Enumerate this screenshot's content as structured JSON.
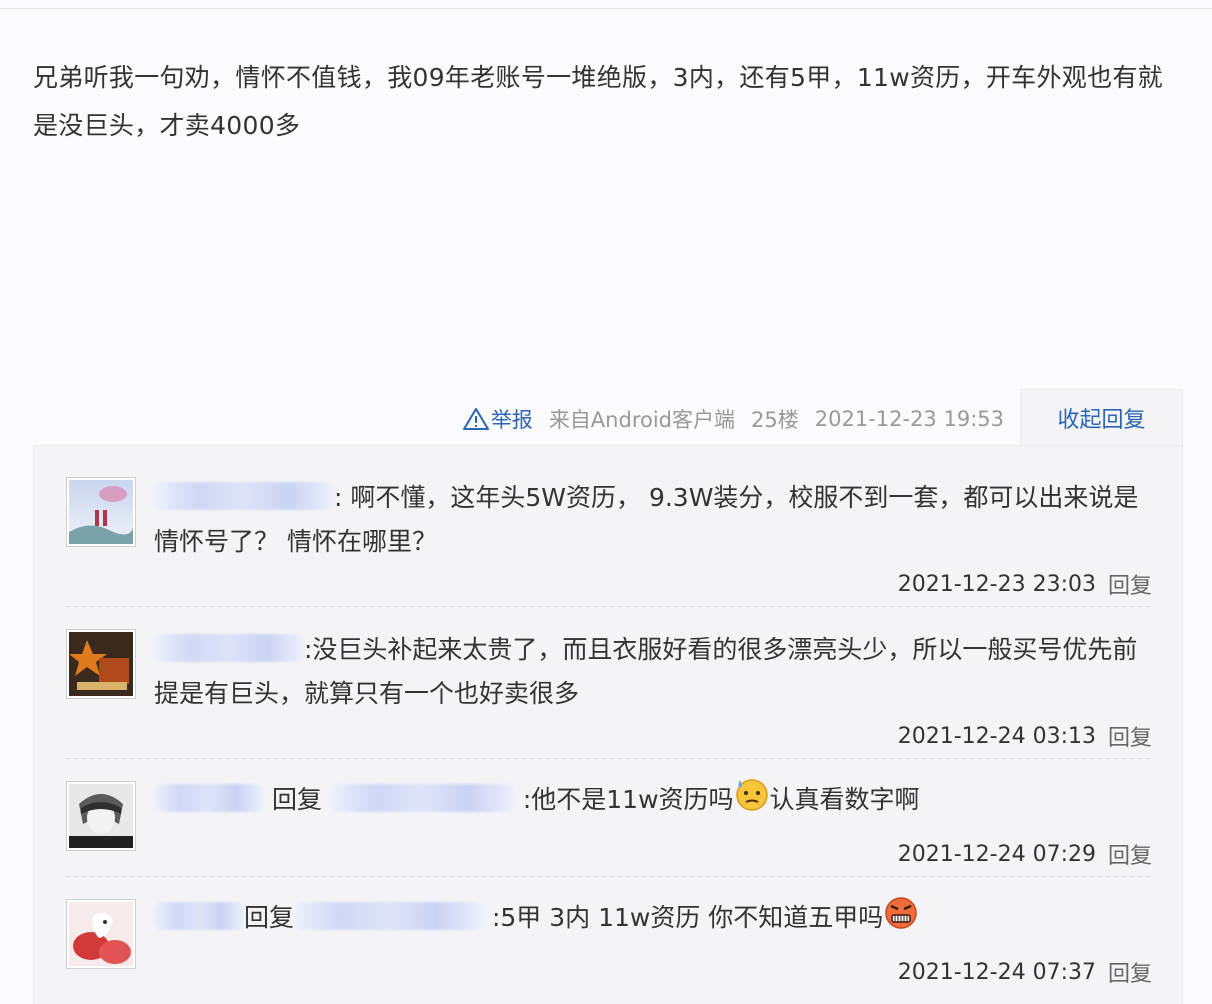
{
  "post": {
    "body": "兄弟听我一句劝，情怀不值钱，我09年老账号一堆绝版，3内，还有5甲，11w资历，开车外观也有就是没巨头，才卖4000多",
    "report_label": "举报",
    "source": "来自Android客户端",
    "floor": "25楼",
    "timestamp": "2021-12-23 19:53",
    "collapse_label": "收起回复"
  },
  "replies": [
    {
      "segments": [
        {
          "type": "name"
        },
        {
          "type": "text",
          "value": ": 啊不懂，这年头5W资历， 9.3W装分，校服不到一套，都可以出来说是情怀号了？ 情怀在哪里？"
        }
      ],
      "timestamp": "2021-12-23 23:03",
      "reply_label": "回复"
    },
    {
      "segments": [
        {
          "type": "name"
        },
        {
          "type": "text",
          "value": ":没巨头补起来太贵了，而且衣服好看的很多漂亮头少，所以一般买号优先前提是有巨头，就算只有一个也好卖很多"
        }
      ],
      "timestamp": "2021-12-24 03:13",
      "reply_label": "回复"
    },
    {
      "segments": [
        {
          "type": "name"
        },
        {
          "type": "text",
          "value": " 回复 "
        },
        {
          "type": "name"
        },
        {
          "type": "text",
          "value": " :他不是11w资历吗"
        },
        {
          "type": "emoji",
          "icon": "sweat-emoji-icon"
        },
        {
          "type": "text",
          "value": "认真看数字啊"
        }
      ],
      "timestamp": "2021-12-24 07:29",
      "reply_label": "回复"
    },
    {
      "segments": [
        {
          "type": "name"
        },
        {
          "type": "text",
          "value": "回复"
        },
        {
          "type": "name"
        },
        {
          "type": "text",
          "value": " :5甲 3内 11w资历 你不知道五甲吗"
        },
        {
          "type": "emoji",
          "icon": "angry-emoji-icon"
        }
      ],
      "timestamp": "2021-12-24 07:37",
      "reply_label": "回复"
    }
  ],
  "colors": {
    "link_blue": "#2d64b3",
    "meta_gray": "#999999",
    "reply_bg": "#f4f4f7"
  }
}
